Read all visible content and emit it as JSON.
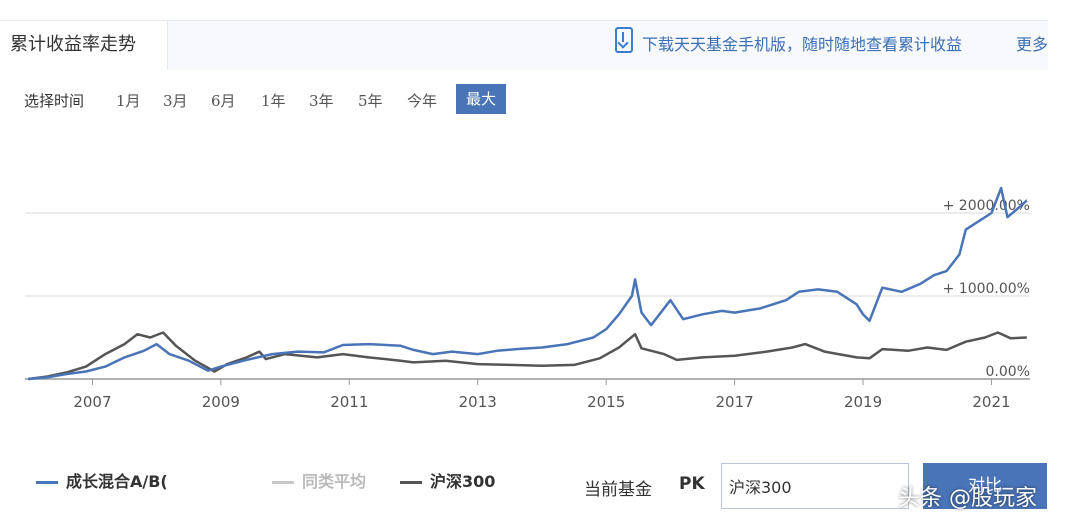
{
  "header": {
    "title": "累计收益率走势",
    "download_text": "下载天天基金手机版，随时随地查看累计收益",
    "more_label": "更多"
  },
  "time_range": {
    "label": "选择时间",
    "options": [
      "1月",
      "3月",
      "6月",
      "1年",
      "3年",
      "5年",
      "今年",
      "最大"
    ],
    "active": "最大"
  },
  "legend": {
    "items": [
      "成长混合A/B(",
      "同类平均",
      "沪深300"
    ]
  },
  "pk": {
    "label": "当前基金",
    "pk_text": "PK",
    "input_value": "沪深300",
    "button_label": "对比"
  },
  "watermark": "头条 @股玩家",
  "colors": {
    "fund": "#4a74b8",
    "peer": "#c8c8c8",
    "index": "#555555",
    "accent": "#4a74b8"
  },
  "icons": [
    "phone-download-icon"
  ],
  "chart_data": {
    "type": "line",
    "x_ticks": [
      "2007",
      "2009",
      "2011",
      "2013",
      "2015",
      "2017",
      "2019",
      "2021"
    ],
    "y_ticks": [
      "0.00%",
      "+ 1000.00%",
      "+ 2000.00%"
    ],
    "xlim": [
      2005.95,
      2021.6
    ],
    "ylim": [
      -200,
      2400
    ],
    "grid": true,
    "series": [
      {
        "name": "成长混合A/B(",
        "color": "#4a74b8",
        "points": [
          [
            2006.0,
            0
          ],
          [
            2006.3,
            20
          ],
          [
            2006.6,
            60
          ],
          [
            2006.9,
            90
          ],
          [
            2007.2,
            150
          ],
          [
            2007.5,
            260
          ],
          [
            2007.8,
            340
          ],
          [
            2008.0,
            420
          ],
          [
            2008.2,
            300
          ],
          [
            2008.5,
            220
          ],
          [
            2008.8,
            100
          ],
          [
            2009.0,
            150
          ],
          [
            2009.4,
            230
          ],
          [
            2009.8,
            300
          ],
          [
            2010.2,
            330
          ],
          [
            2010.6,
            320
          ],
          [
            2010.9,
            410
          ],
          [
            2011.3,
            420
          ],
          [
            2011.8,
            400
          ],
          [
            2012.0,
            350
          ],
          [
            2012.3,
            300
          ],
          [
            2012.6,
            330
          ],
          [
            2013.0,
            300
          ],
          [
            2013.3,
            340
          ],
          [
            2013.6,
            360
          ],
          [
            2014.0,
            380
          ],
          [
            2014.4,
            420
          ],
          [
            2014.8,
            500
          ],
          [
            2015.0,
            600
          ],
          [
            2015.2,
            780
          ],
          [
            2015.4,
            1000
          ],
          [
            2015.45,
            1200
          ],
          [
            2015.55,
            800
          ],
          [
            2015.7,
            650
          ],
          [
            2016.0,
            950
          ],
          [
            2016.2,
            720
          ],
          [
            2016.5,
            780
          ],
          [
            2016.8,
            820
          ],
          [
            2017.0,
            800
          ],
          [
            2017.4,
            850
          ],
          [
            2017.8,
            950
          ],
          [
            2018.0,
            1050
          ],
          [
            2018.3,
            1080
          ],
          [
            2018.6,
            1050
          ],
          [
            2018.9,
            900
          ],
          [
            2019.0,
            780
          ],
          [
            2019.1,
            700
          ],
          [
            2019.3,
            1100
          ],
          [
            2019.6,
            1050
          ],
          [
            2019.9,
            1150
          ],
          [
            2020.1,
            1250
          ],
          [
            2020.3,
            1300
          ],
          [
            2020.5,
            1500
          ],
          [
            2020.6,
            1800
          ],
          [
            2020.8,
            1900
          ],
          [
            2021.0,
            2000
          ],
          [
            2021.15,
            2300
          ],
          [
            2021.25,
            1950
          ],
          [
            2021.4,
            2050
          ],
          [
            2021.55,
            2150
          ]
        ]
      },
      {
        "name": "沪深300",
        "color": "#555555",
        "points": [
          [
            2006.0,
            0
          ],
          [
            2006.3,
            30
          ],
          [
            2006.6,
            80
          ],
          [
            2006.9,
            150
          ],
          [
            2007.2,
            300
          ],
          [
            2007.5,
            420
          ],
          [
            2007.7,
            540
          ],
          [
            2007.9,
            500
          ],
          [
            2008.1,
            560
          ],
          [
            2008.3,
            400
          ],
          [
            2008.6,
            220
          ],
          [
            2008.9,
            90
          ],
          [
            2009.1,
            180
          ],
          [
            2009.4,
            260
          ],
          [
            2009.6,
            330
          ],
          [
            2009.7,
            240
          ],
          [
            2010.0,
            300
          ],
          [
            2010.5,
            260
          ],
          [
            2010.9,
            300
          ],
          [
            2011.3,
            260
          ],
          [
            2011.8,
            220
          ],
          [
            2012.0,
            200
          ],
          [
            2012.5,
            220
          ],
          [
            2013.0,
            180
          ],
          [
            2013.5,
            170
          ],
          [
            2014.0,
            160
          ],
          [
            2014.5,
            170
          ],
          [
            2014.9,
            250
          ],
          [
            2015.2,
            380
          ],
          [
            2015.45,
            540
          ],
          [
            2015.55,
            370
          ],
          [
            2015.9,
            300
          ],
          [
            2016.1,
            230
          ],
          [
            2016.5,
            260
          ],
          [
            2017.0,
            280
          ],
          [
            2017.5,
            330
          ],
          [
            2017.9,
            380
          ],
          [
            2018.1,
            420
          ],
          [
            2018.4,
            330
          ],
          [
            2018.9,
            260
          ],
          [
            2019.1,
            250
          ],
          [
            2019.3,
            360
          ],
          [
            2019.7,
            340
          ],
          [
            2020.0,
            380
          ],
          [
            2020.3,
            350
          ],
          [
            2020.6,
            450
          ],
          [
            2020.9,
            500
          ],
          [
            2021.1,
            560
          ],
          [
            2021.3,
            490
          ],
          [
            2021.55,
            500
          ]
        ]
      }
    ]
  }
}
